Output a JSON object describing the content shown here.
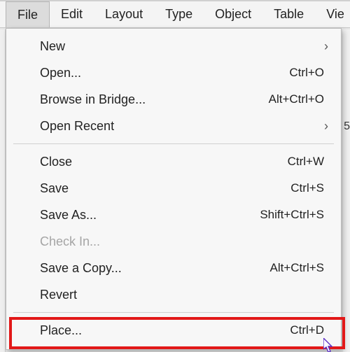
{
  "menubar": {
    "items": [
      "File",
      "Edit",
      "Layout",
      "Type",
      "Object",
      "Table",
      "Vie"
    ],
    "openIndex": 0
  },
  "dropdown": {
    "groups": [
      [
        {
          "label": "New",
          "shortcut": "",
          "submenu": true,
          "disabled": false
        },
        {
          "label": "Open...",
          "shortcut": "Ctrl+O",
          "submenu": false,
          "disabled": false
        },
        {
          "label": "Browse in Bridge...",
          "shortcut": "Alt+Ctrl+O",
          "submenu": false,
          "disabled": false
        },
        {
          "label": "Open Recent",
          "shortcut": "",
          "submenu": true,
          "disabled": false
        }
      ],
      [
        {
          "label": "Close",
          "shortcut": "Ctrl+W",
          "submenu": false,
          "disabled": false
        },
        {
          "label": "Save",
          "shortcut": "Ctrl+S",
          "submenu": false,
          "disabled": false
        },
        {
          "label": "Save As...",
          "shortcut": "Shift+Ctrl+S",
          "submenu": false,
          "disabled": false
        },
        {
          "label": "Check In...",
          "shortcut": "",
          "submenu": false,
          "disabled": true
        },
        {
          "label": "Save a Copy...",
          "shortcut": "Alt+Ctrl+S",
          "submenu": false,
          "disabled": false
        },
        {
          "label": "Revert",
          "shortcut": "",
          "submenu": false,
          "disabled": false
        }
      ],
      [
        {
          "label": "Place...",
          "shortcut": "Ctrl+D",
          "submenu": false,
          "disabled": false
        }
      ]
    ],
    "highlighted": {
      "group": 2,
      "index": 0
    }
  },
  "background": {
    "rightHint": "5"
  }
}
